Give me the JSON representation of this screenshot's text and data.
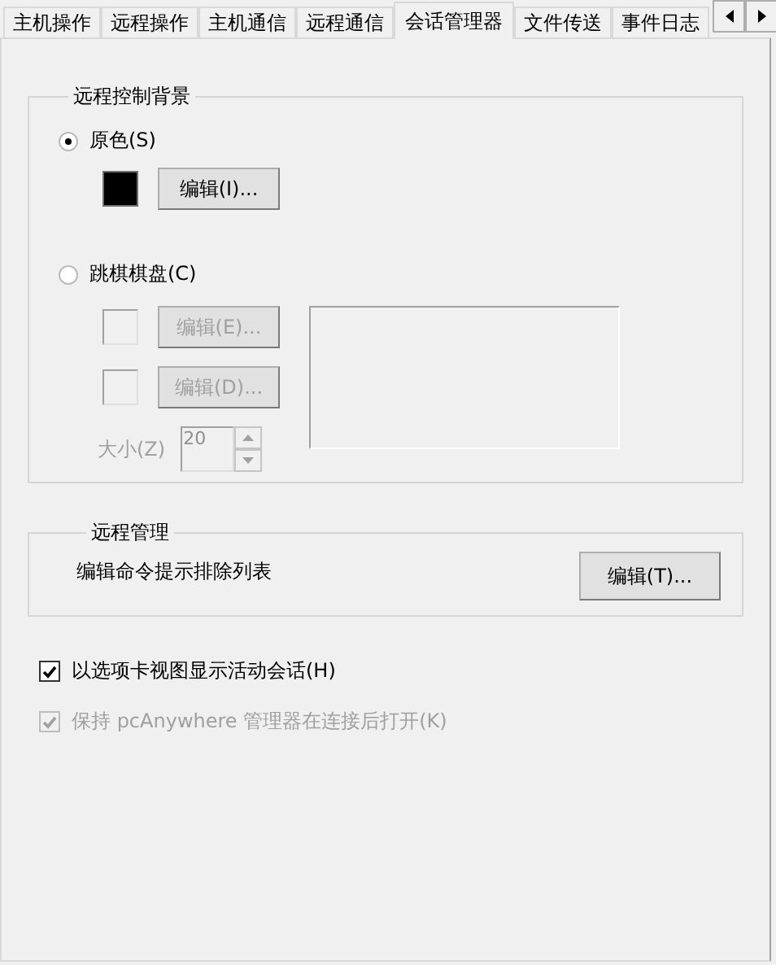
{
  "tabs": [
    {
      "label": "主机操作",
      "selected": false
    },
    {
      "label": "远程操作",
      "selected": false
    },
    {
      "label": "主机通信",
      "selected": false
    },
    {
      "label": "远程通信",
      "selected": false
    },
    {
      "label": "会话管理器",
      "selected": true
    },
    {
      "label": "文件传送",
      "selected": false
    },
    {
      "label": "事件日志",
      "selected": false
    }
  ],
  "remote_background": {
    "title": "远程控制背景",
    "solid_color": {
      "label": "原色(S)",
      "selected": true,
      "edit_button": "编辑(I)..."
    },
    "checkerboard": {
      "label": "跳棋棋盘(C)",
      "selected": false,
      "disabled": true,
      "edit_buttons": [
        "编辑(E)...",
        "编辑(D)..."
      ],
      "size_label": "大小(Z)",
      "size_value": "20"
    }
  },
  "remote_management": {
    "title": "远程管理",
    "description": "编辑命令提示排除列表",
    "edit_button": "编辑(T)..."
  },
  "options": [
    {
      "label": "以选项卡视图显示活动会话(H)",
      "checked": true,
      "disabled": false
    },
    {
      "label": "保持 pcAnywhere 管理器在连接后打开(K)",
      "checked": true,
      "disabled": true
    }
  ]
}
